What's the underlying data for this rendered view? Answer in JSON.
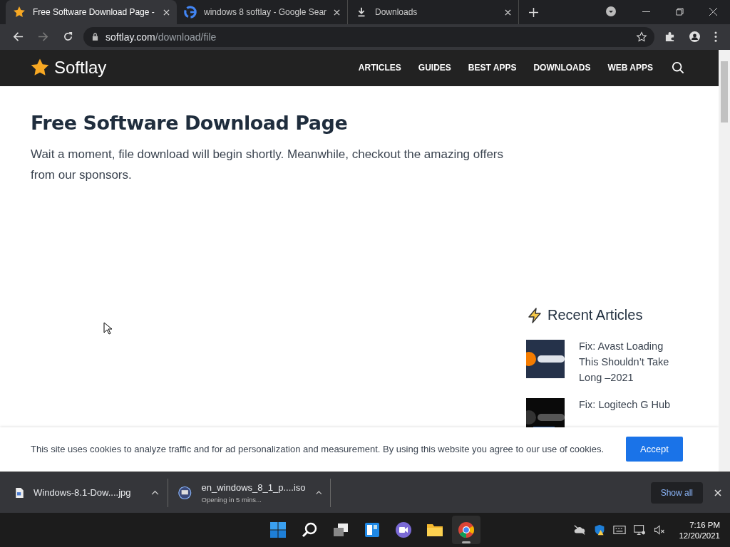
{
  "tabs": [
    {
      "title": "Free Software Download Page -",
      "kind": "star",
      "selected": true
    },
    {
      "title": "windows 8 softlay - Google Sear",
      "kind": "google",
      "selected": false
    },
    {
      "title": "Downloads",
      "kind": "download",
      "selected": false
    }
  ],
  "address": {
    "host": "softlay.com",
    "path": "/download/file"
  },
  "site": {
    "logo": "Softlay",
    "nav": [
      "ARTICLES",
      "GUIDES",
      "BEST APPS",
      "DOWNLOADS",
      "WEB APPS"
    ]
  },
  "page": {
    "heading": "Free Software Download Page",
    "intro": "Wait a moment, file download will begin shortly. Meanwhile, checkout the amazing offers from our sponsors."
  },
  "recent": {
    "title": "Recent Articles",
    "articles": [
      {
        "title": "Fix: Avast Loading This Shouldn’t Take Long –2021",
        "kind": "picture"
      },
      {
        "title": "Fix: Logitech G Hub",
        "kind": "picture"
      }
    ]
  },
  "cookie": {
    "text": "This site uses cookies to analyze traffic and for ad personalization and measurement. By using this website you agree to our use of cookies.",
    "button": "Accept"
  },
  "downloads": {
    "items": [
      {
        "name": "Windows-8.1-Dow....jpg",
        "kind": "file"
      },
      {
        "name": "en_windows_8_1_p....iso",
        "status": "Opening in 5 mins...",
        "kind": "disc"
      }
    ],
    "show_all": "Show all"
  },
  "taskbar": {
    "apps": [
      {
        "kind": "start",
        "active": false
      },
      {
        "kind": "search",
        "active": false
      },
      {
        "kind": "taskview",
        "active": false
      },
      {
        "kind": "widgets",
        "active": false
      },
      {
        "kind": "chat",
        "active": false
      },
      {
        "kind": "explorer",
        "active": false
      },
      {
        "kind": "chrome",
        "active": true
      }
    ],
    "time": "7:16 PM",
    "date": "12/20/2021"
  }
}
